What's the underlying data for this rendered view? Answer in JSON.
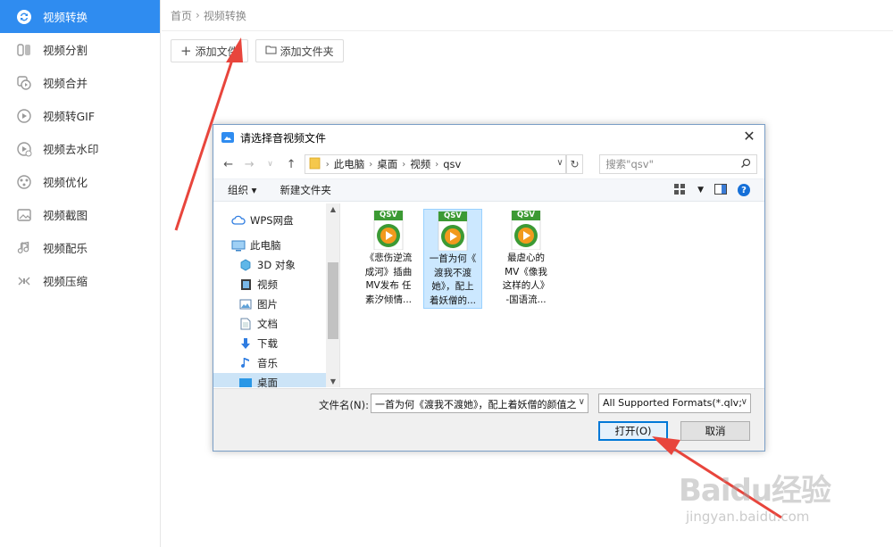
{
  "sidebar": {
    "items": [
      {
        "label": "视频转换",
        "icon": "convert-icon",
        "active": true
      },
      {
        "label": "视频分割",
        "icon": "split-icon"
      },
      {
        "label": "视频合并",
        "icon": "merge-icon"
      },
      {
        "label": "视频转GIF",
        "icon": "gif-icon"
      },
      {
        "label": "视频去水印",
        "icon": "watermark-remove-icon"
      },
      {
        "label": "视频优化",
        "icon": "optimize-icon"
      },
      {
        "label": "视频截图",
        "icon": "screenshot-icon"
      },
      {
        "label": "视频配乐",
        "icon": "music-icon"
      },
      {
        "label": "视频压缩",
        "icon": "compress-icon"
      }
    ]
  },
  "breadcrumb": {
    "home": "首页",
    "sep": "›",
    "current": "视频转换"
  },
  "toolbar": {
    "add_file": "添加文件",
    "add_folder": "添加文件夹"
  },
  "dialog": {
    "title": "请选择音视频文件",
    "close": "✕",
    "address": {
      "segments": [
        "此电脑",
        "桌面",
        "视频",
        "qsv"
      ]
    },
    "search_placeholder": "搜索\"qsv\"",
    "organize": "组织 ▾",
    "new_folder": "新建文件夹",
    "tree": [
      {
        "label": "WPS网盘",
        "icon": "cloud-icon"
      },
      {
        "label": "此电脑",
        "icon": "computer-icon"
      },
      {
        "label": "3D 对象",
        "icon": "cube-icon"
      },
      {
        "label": "视频",
        "icon": "video-folder-icon"
      },
      {
        "label": "图片",
        "icon": "pictures-icon"
      },
      {
        "label": "文档",
        "icon": "documents-icon"
      },
      {
        "label": "下载",
        "icon": "download-icon"
      },
      {
        "label": "音乐",
        "icon": "music-note-icon"
      },
      {
        "label": "桌面",
        "icon": "desktop-icon",
        "selected": true
      }
    ],
    "files": [
      {
        "name": "《悲伤逆流成河》插曲MV发布 任素汐倾情...",
        "lines": [
          "《悲伤逆流",
          "成河》插曲",
          "MV发布 任",
          "素汐倾情..."
        ]
      },
      {
        "name": "一首为何《渡我不渡她》，配上着妖僧的...",
        "lines": [
          "一首为何《",
          "渡我不渡",
          "她》，配上",
          "着妖僧的..."
        ],
        "selected": true
      },
      {
        "name": "最虐心的MV《像我这样的人》-国语流...",
        "lines": [
          "最虐心的",
          "MV《像我",
          "这样的人》",
          "-国语流..."
        ]
      }
    ],
    "file_icon_label": "QSV",
    "filename_label": "文件名(N):",
    "filename_value": "一首为何《渡我不渡她》，配上着妖僧的颜值之",
    "format_value": "All Supported Formats(*.qlv;",
    "open_button": "打开(O)",
    "cancel_button": "取消"
  },
  "watermark": {
    "logo": "Baidu经验",
    "url": "jingyan.baidu.com"
  },
  "colors": {
    "accent": "#2f8cf0",
    "arrow": "#e8453c",
    "qsv_green": "#3c9a34",
    "qsv_orange": "#f29a1d"
  }
}
